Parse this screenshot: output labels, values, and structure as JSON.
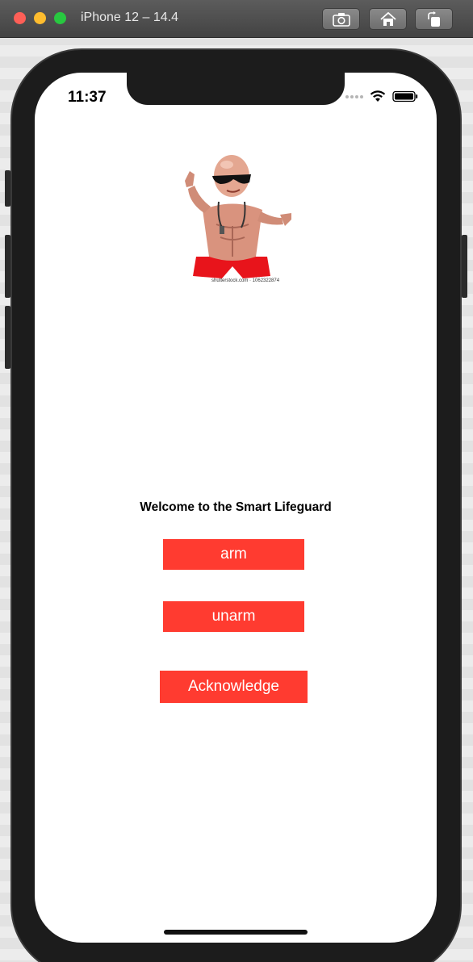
{
  "window": {
    "title": "iPhone 12 – 14.4",
    "toolbar": {
      "screenshot_icon": "camera-icon",
      "home_icon": "home-icon",
      "rotate_icon": "rotate-icon"
    }
  },
  "status_bar": {
    "time": "11:37",
    "icons": [
      "signal-dots-icon",
      "wifi-icon",
      "battery-icon"
    ]
  },
  "hero_image": {
    "subject": "cartoon muscular lifeguard with sunglasses",
    "watermark": "shutterstock.com · 1062322874"
  },
  "main": {
    "welcome_text": "Welcome to the Smart Lifeguard",
    "buttons": {
      "arm": "arm",
      "unarm": "unarm",
      "acknowledge": "Acknowledge"
    }
  },
  "colors": {
    "button_bg": "#ff3b30",
    "button_text": "#ffffff",
    "screen_bg": "#ffffff"
  }
}
